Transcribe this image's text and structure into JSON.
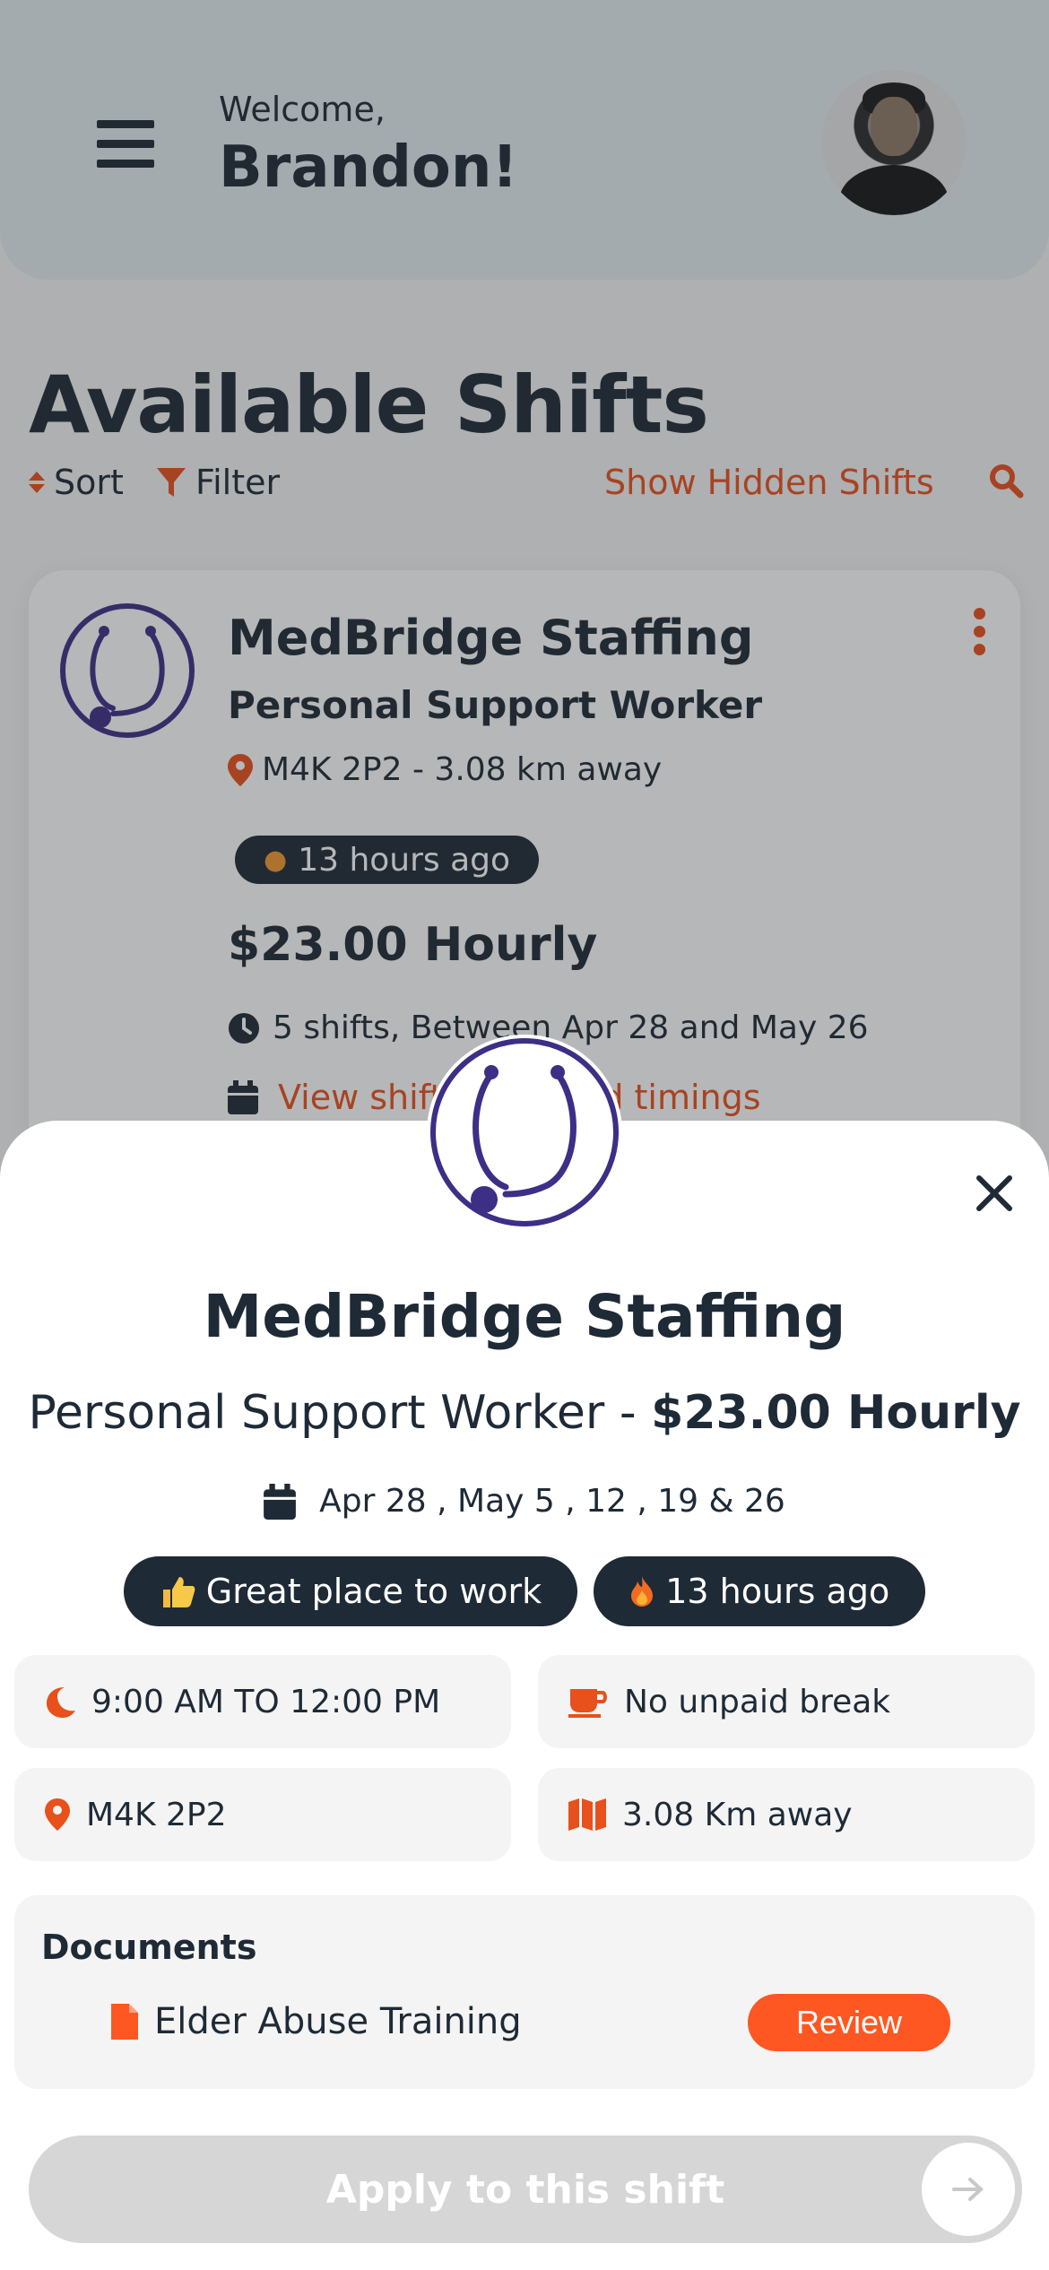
{
  "header": {
    "welcome": "Welcome,",
    "user_name": "Brandon!"
  },
  "page": {
    "title": "Available Shifts",
    "sort_label": "Sort",
    "filter_label": "Filter",
    "hidden_label": "Show Hidden Shifts"
  },
  "card": {
    "company": "MedBridge Staffing",
    "role": "Personal Support Worker",
    "location": "M4K 2P2 - 3.08 km away",
    "posted": "13 hours ago",
    "rate": "$23.00 Hourly",
    "shifts": "5 shifts, Between Apr 28 and May 26",
    "view_link": "View shift dates and timings"
  },
  "sheet": {
    "company": "MedBridge Staffing",
    "role": "Personal Support Worker -",
    "rate": "$23.00 Hourly",
    "dates": "Apr 28 , May 5 , 12 , 19 & 26",
    "badge_great": "Great place to work",
    "badge_posted": "13 hours ago",
    "time": "9:00 AM TO 12:00 PM",
    "break": "No unpaid break",
    "postal": "M4K 2P2",
    "distance": "3.08 Km away",
    "documents_title": "Documents",
    "document_name": "Elder Abuse Training",
    "review_label": "Review",
    "apply_label": "Apply to this shift"
  },
  "colors": {
    "accent": "#e8501c",
    "dark": "#1e2a36",
    "brand_purple": "#3d2e86"
  }
}
